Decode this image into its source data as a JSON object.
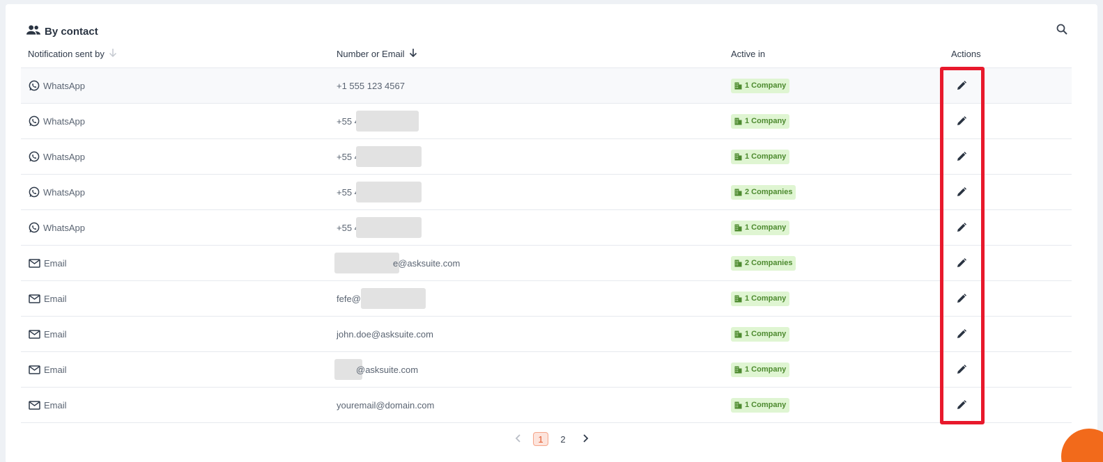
{
  "header": {
    "title": "By contact",
    "icon": "people-icon",
    "search_icon": "search-icon"
  },
  "columns": {
    "sent_by": "Notification sent by",
    "number_or_email": "Number or Email",
    "active_in": "Active in",
    "actions": "Actions"
  },
  "rows": [
    {
      "type": "WhatsApp",
      "icon": "whatsapp-icon",
      "prefix": "+1 555 123 4567",
      "suffix": "",
      "redacted": false,
      "active": "1 Company"
    },
    {
      "type": "WhatsApp",
      "icon": "whatsapp-icon",
      "prefix": "+55 4",
      "suffix": "",
      "redacted": true,
      "active": "1 Company"
    },
    {
      "type": "WhatsApp",
      "icon": "whatsapp-icon",
      "prefix": "+55 4",
      "suffix": "",
      "redacted": true,
      "active": "1 Company"
    },
    {
      "type": "WhatsApp",
      "icon": "whatsapp-icon",
      "prefix": "+55 4",
      "suffix": "",
      "redacted": true,
      "active": "2 Companies"
    },
    {
      "type": "WhatsApp",
      "icon": "whatsapp-icon",
      "prefix": "+55 4",
      "suffix": "",
      "redacted": true,
      "active": "1 Company"
    },
    {
      "type": "Email",
      "icon": "mail-icon",
      "prefix": "",
      "suffix": "e@asksuite.com",
      "redacted": true,
      "active": "2 Companies"
    },
    {
      "type": "Email",
      "icon": "mail-icon",
      "prefix": "fefe@",
      "suffix": "",
      "redacted": true,
      "active": "1 Company"
    },
    {
      "type": "Email",
      "icon": "mail-icon",
      "prefix": "john.doe@asksuite.com",
      "suffix": "",
      "redacted": false,
      "active": "1 Company"
    },
    {
      "type": "Email",
      "icon": "mail-icon",
      "prefix": "",
      "suffix": "@asksuite.com",
      "redacted": true,
      "active": "1 Company"
    },
    {
      "type": "Email",
      "icon": "mail-icon",
      "prefix": "youremail@domain.com",
      "suffix": "",
      "redacted": false,
      "active": "1 Company"
    }
  ],
  "pagination": {
    "pages": [
      "1",
      "2"
    ],
    "current": "1"
  },
  "colors": {
    "accent": "#e1572c",
    "highlight": "#e8192c",
    "badge_bg": "#dff5d2",
    "badge_text": "#4d8a2f"
  }
}
